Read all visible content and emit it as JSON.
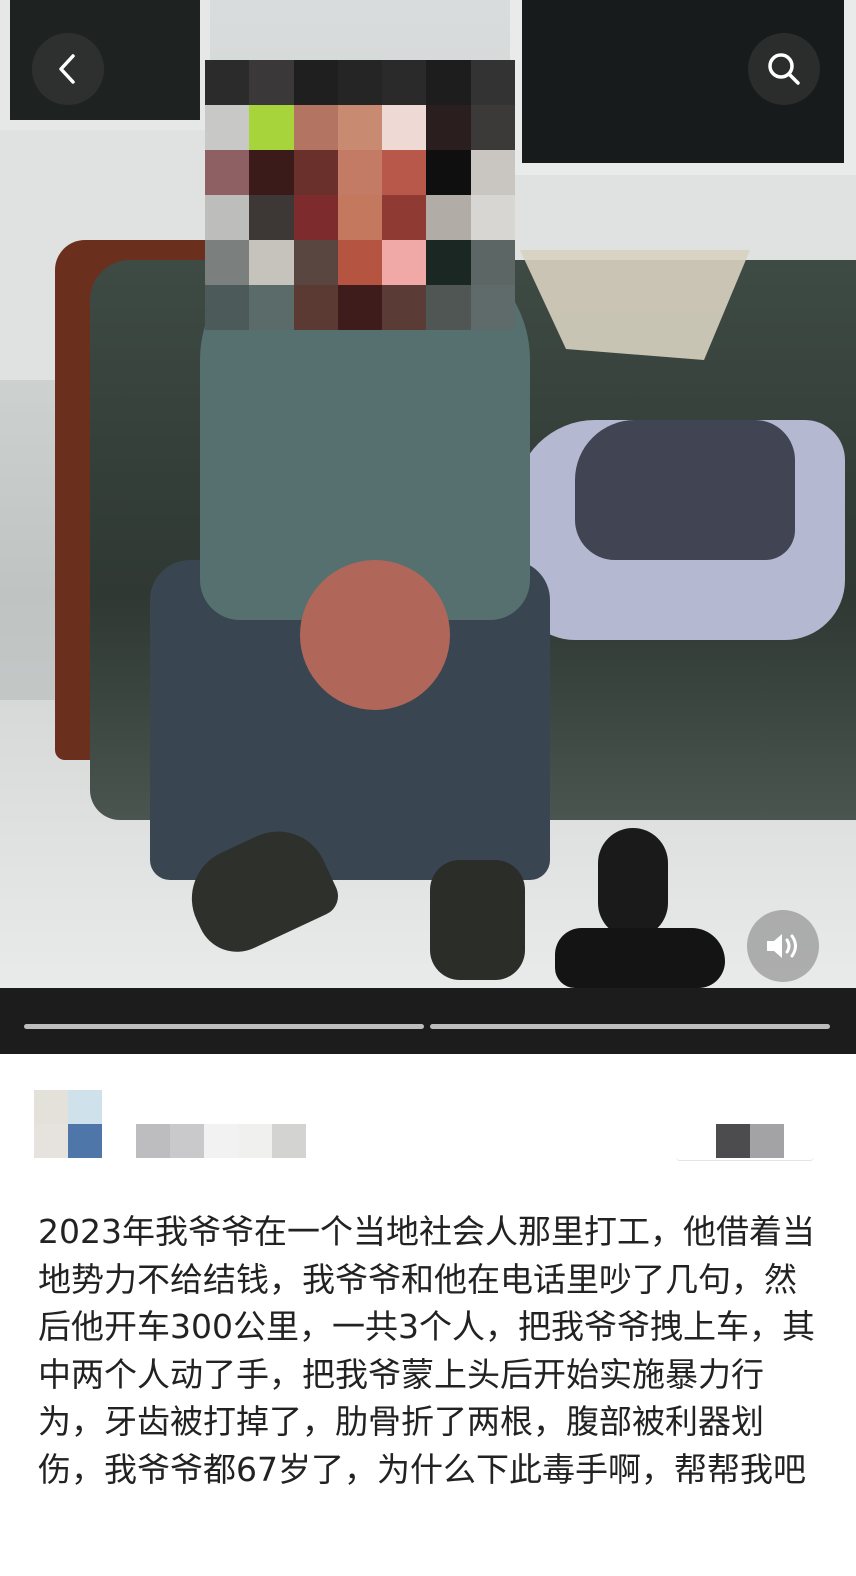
{
  "nav": {
    "back_icon": "chevron-left-icon",
    "search_icon": "search-icon",
    "sound_icon": "speaker-icon"
  },
  "media": {
    "slide_count": 2,
    "active_slide": 1
  },
  "post": {
    "body": "2023年我爷爷在一个当地社会人那里打工，他借着当地势力不给结钱，我爷爷和他在电话里吵了几句，然后他开车300公里，一共3个人，把我爷爷拽上车，其中两个人动了手，把我爷蒙上头后开始实施暴力行为，牙齿被打掉了，肋骨折了两根，腹部被利器划伤，我爷爷都67岁了，为什么下此毒手啊，帮帮我吧"
  },
  "colors": {
    "progress_track": "#1c1c1c",
    "progress_segment": "#bdbdbd",
    "text": "#222222"
  }
}
